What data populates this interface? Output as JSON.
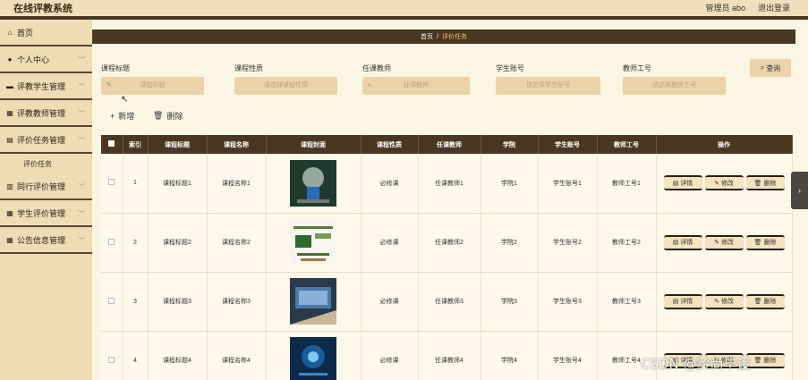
{
  "app": {
    "title": "在线评教系统"
  },
  "user": {
    "label": "管理员 abo",
    "logout": "退出登录"
  },
  "sidebar": {
    "items": [
      {
        "label": "首页",
        "icon": "home-icon"
      },
      {
        "label": "个人中心",
        "icon": "user-icon"
      },
      {
        "label": "评教学生管理",
        "icon": "folder-icon"
      },
      {
        "label": "评教教师管理",
        "icon": "grid-icon"
      },
      {
        "label": "评价任务管理",
        "icon": "doc-icon"
      },
      {
        "label": "同行评价管理",
        "icon": "table-icon"
      },
      {
        "label": "学生评价管理",
        "icon": "grid-icon"
      },
      {
        "label": "公告信息管理",
        "icon": "grid-icon"
      }
    ],
    "sub_item": "评价任务"
  },
  "breadcrumb": {
    "home": "首页",
    "separator": "/",
    "current": "评价任务"
  },
  "filters": [
    {
      "label": "课程标题",
      "placeholder": "课程标题"
    },
    {
      "label": "课程性质",
      "placeholder": "请选择课程性质"
    },
    {
      "label": "任课教师",
      "placeholder": "任课教师"
    },
    {
      "label": "学生账号",
      "placeholder": "请选择学生账号"
    },
    {
      "label": "教师工号",
      "placeholder": "请选择教师工号"
    }
  ],
  "toolbar": {
    "query": "查询",
    "add": "新增",
    "delete": "删除"
  },
  "table": {
    "headers": [
      "索引",
      "课程标题",
      "课程名称",
      "课程封面",
      "课程性质",
      "任课教师",
      "学院",
      "学生账号",
      "教师工号",
      "操作"
    ],
    "rows": [
      {
        "index": "1",
        "title": "课程标题1",
        "name": "课程名称1",
        "cover": "cover-image-1",
        "nature": "必修课",
        "teacher": "任课教师1",
        "college": "学院1",
        "student": "学生账号1",
        "teacher_id": "教师工号1"
      },
      {
        "index": "2",
        "title": "课程标题2",
        "name": "课程名称2",
        "cover": "cover-image-2",
        "nature": "必修课",
        "teacher": "任课教师2",
        "college": "学院2",
        "student": "学生账号2",
        "teacher_id": "教师工号2"
      },
      {
        "index": "3",
        "title": "课程标题3",
        "name": "课程名称3",
        "cover": "cover-image-3",
        "nature": "必修课",
        "teacher": "任课教师3",
        "college": "学院3",
        "student": "学生账号3",
        "teacher_id": "教师工号3"
      },
      {
        "index": "4",
        "title": "课程标题4",
        "name": "课程名称4",
        "cover": "cover-image-4",
        "nature": "必修课",
        "teacher": "任课教师4",
        "college": "学院4",
        "student": "学生账号4",
        "teacher_id": "教师工号4"
      }
    ],
    "ops": {
      "detail": "详情",
      "edit": "修改",
      "delete": "删除"
    }
  },
  "watermark": "CSDN @黔尚毕设",
  "colors": {
    "header": "#4a3721",
    "sidebar": "#efdcb4",
    "input": "#ead3a8",
    "page": "#fbf5e3"
  }
}
